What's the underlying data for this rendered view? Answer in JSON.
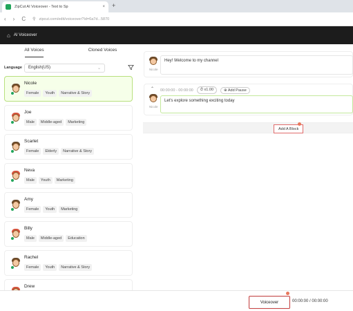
{
  "browser": {
    "tab_title": "ZipCut AI Voiceover - Text to Sp",
    "tab_close": "×",
    "new_tab": "+",
    "nav_back": "‹",
    "nav_forward": "›",
    "nav_reload": "C",
    "url": "zipcut.com/edit/voiceover?Id=6a7d...5870"
  },
  "app": {
    "title": "AI Voiceover"
  },
  "voice_tabs": [
    "All Voices",
    "Cloned Voices"
  ],
  "language": {
    "label": "Language",
    "value": "English(US)"
  },
  "voices": [
    {
      "name": "Nicole",
      "tags": [
        "Female",
        "Youth",
        "Narrative & Story"
      ],
      "hair": "brown",
      "selected": true
    },
    {
      "name": "Joe",
      "tags": [
        "Male",
        "Middle-aged",
        "Marketing"
      ],
      "hair": "red",
      "selected": false
    },
    {
      "name": "Scarlet",
      "tags": [
        "Female",
        "Elderly",
        "Narrative & Story"
      ],
      "hair": "brown",
      "selected": false
    },
    {
      "name": "Neva",
      "tags": [
        "Male",
        "Youth",
        "Marketing"
      ],
      "hair": "red",
      "selected": false
    },
    {
      "name": "Amy",
      "tags": [
        "Female",
        "Youth",
        "Marketing"
      ],
      "hair": "brown",
      "selected": false
    },
    {
      "name": "Billy",
      "tags": [
        "Male",
        "Middle-aged",
        "Education"
      ],
      "hair": "red",
      "selected": false
    },
    {
      "name": "Rachel",
      "tags": [
        "Female",
        "Youth",
        "Narrative & Story"
      ],
      "hair": "brown",
      "selected": false
    },
    {
      "name": "Drew",
      "tags": [],
      "hair": "red",
      "selected": false
    }
  ],
  "blocks": [
    {
      "speaker": "Nicole",
      "text": "Hey! Welcome to my channel"
    },
    {
      "speaker": "Nicole",
      "time": "00:00:00 - 00:00:00",
      "speed": "x1.00",
      "pause_label": "Add Pause",
      "text": "Let's explore something exciting today"
    }
  ],
  "add_block_label": "Add A Block",
  "footer": {
    "voiceover_label": "Voiceover",
    "timecode": "00:00:00 / 00:00:00"
  }
}
